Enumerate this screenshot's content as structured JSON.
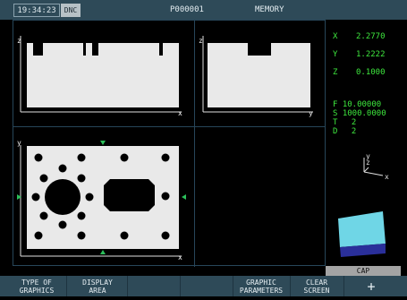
{
  "header": {
    "clock": "19:34:23",
    "mode": "DNC",
    "program": "P000001",
    "memory_label": "MEMORY"
  },
  "views": {
    "xz": {
      "vertical_axis": "z",
      "horizontal_axis": "x"
    },
    "yz": {
      "vertical_axis": "z",
      "horizontal_axis": "y"
    },
    "xy": {
      "vertical_axis": "y",
      "horizontal_axis": "x"
    }
  },
  "position": {
    "x_label": "X",
    "x_value": "2.2770",
    "y_label": "Y",
    "y_value": "1.2222",
    "z_label": "Z",
    "z_value": "0.1000"
  },
  "params": {
    "f_label": "F",
    "f_value": "10.00000",
    "s_label": "S",
    "s_value": "1000.0000",
    "t_label": "T",
    "t_value": "2",
    "d_label": "D",
    "d_value": "2"
  },
  "triad": {
    "y": "y",
    "z": "z",
    "x": "x"
  },
  "cap_label": "CAP",
  "colors": {
    "marker": "#2bbf5a",
    "text_green": "#3ee83e",
    "bar": "#2e4a58",
    "part": "#e9e9e9",
    "cube_top": "#6fd6e6",
    "cube_side": "#2a2f9a"
  },
  "softkeys": [
    {
      "line1": "TYPE OF",
      "line2": "GRAPHICS"
    },
    {
      "line1": "DISPLAY",
      "line2": "AREA"
    },
    {
      "line1": "",
      "line2": ""
    },
    {
      "line1": "",
      "line2": ""
    },
    {
      "line1": "GRAPHIC",
      "line2": "PARAMETERS"
    },
    {
      "line1": "CLEAR",
      "line2": "SCREEN"
    },
    {
      "line1": "+",
      "line2": ""
    }
  ]
}
